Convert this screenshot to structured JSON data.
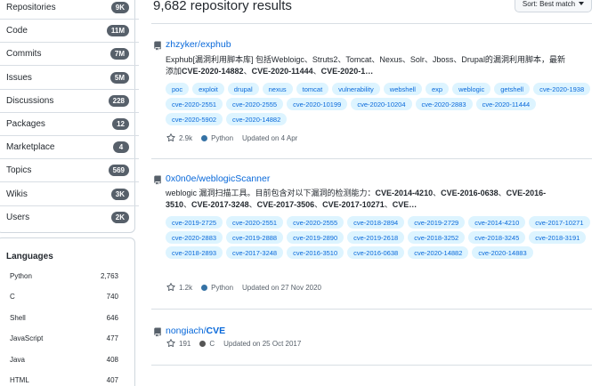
{
  "sidebar": {
    "items": [
      {
        "label": "Repositories",
        "count": "9K"
      },
      {
        "label": "Code",
        "count": "11M"
      },
      {
        "label": "Commits",
        "count": "7M"
      },
      {
        "label": "Issues",
        "count": "5M"
      },
      {
        "label": "Discussions",
        "count": "228"
      },
      {
        "label": "Packages",
        "count": "12"
      },
      {
        "label": "Marketplace",
        "count": "4"
      },
      {
        "label": "Topics",
        "count": "569"
      },
      {
        "label": "Wikis",
        "count": "3K"
      },
      {
        "label": "Users",
        "count": "2K"
      }
    ]
  },
  "languages": {
    "title": "Languages",
    "items": [
      {
        "name": "Python",
        "count": "2,763"
      },
      {
        "name": "C",
        "count": "740"
      },
      {
        "name": "Shell",
        "count": "646"
      },
      {
        "name": "JavaScript",
        "count": "477"
      },
      {
        "name": "Java",
        "count": "408"
      },
      {
        "name": "HTML",
        "count": "407"
      }
    ]
  },
  "header": {
    "results": "9,682 repository results",
    "sort_prefix": "Sort:",
    "sort_value": "Best match"
  },
  "results": [
    {
      "owner": "zhzyker/",
      "name": "exphub",
      "desc_line1": "Exphub[漏洞利用脚本库] 包括Webloigc、Struts2、Tomcat、Nexus、Solr、Jboss、Drupal的漏洞利用脚本，最新",
      "desc_line2_prefix": "添加",
      "desc_line2_a": "CVE-2020-14882",
      "desc_line2_sep1": "、",
      "desc_line2_b": "CVE-2020-11444",
      "desc_line2_sep2": "、",
      "desc_line2_c": "CVE-2020-1…",
      "topics": [
        "poc",
        "exploit",
        "drupal",
        "nexus",
        "tomcat",
        "vulnerability",
        "webshell",
        "exp",
        "weblogic",
        "getshell",
        "cve-2020-1938",
        "cve-2020-2551",
        "cve-2020-2555",
        "cve-2020-10199",
        "cve-2020-10204",
        "cve-2020-2883",
        "cve-2020-11444",
        "cve-2020-5902",
        "cve-2020-14882"
      ],
      "stars": "2.9k",
      "language": "Python",
      "language_color": "#3572A5",
      "updated": "Updated on 4 Apr"
    },
    {
      "owner": "0x0n0e/",
      "name": "weblogicScanner",
      "desc_line1_prefix": "weblogic 漏洞扫描工具。目前包含对以下漏洞的检测能力：",
      "desc_line1_a": "CVE-2014-4210",
      "desc_line1_sep1": "、",
      "desc_line1_b": "CVE-2016-0638",
      "desc_line1_sep2": "、",
      "desc_line1_c": "CVE-2016-",
      "desc_line2_a": "3510",
      "desc_line2_sep1": "、",
      "desc_line2_b": "CVE-2017-3248",
      "desc_line2_sep2": "、",
      "desc_line2_c": "CVE-2017-3506",
      "desc_line2_sep3": "、",
      "desc_line2_d": "CVE-2017-10271",
      "desc_line2_sep4": "、",
      "desc_line2_e": "CVE…",
      "topics": [
        "cve-2019-2725",
        "cve-2020-2551",
        "cve-2020-2555",
        "cve-2018-2894",
        "cve-2019-2729",
        "cve-2014-4210",
        "cve-2017-10271",
        "cve-2020-2883",
        "cve-2019-2888",
        "cve-2019-2890",
        "cve-2019-2618",
        "cve-2018-3252",
        "cve-2018-3245",
        "cve-2018-3191",
        "cve-2018-2893",
        "cve-2017-3248",
        "cve-2016-3510",
        "cve-2016-0638",
        "cve-2020-14882",
        "cve-2020-14883"
      ],
      "stars": "1.2k",
      "language": "Python",
      "language_color": "#3572A5",
      "updated": "Updated on 27 Nov 2020"
    },
    {
      "owner": "nongiach/",
      "name": "CVE",
      "stars": "191",
      "language": "C",
      "language_color": "#555555",
      "updated": "Updated on 25 Oct 2017"
    }
  ],
  "colors": {
    "link": "#0969da",
    "topic_bg": "#ddf4ff",
    "counter_bg": "#57606a"
  }
}
